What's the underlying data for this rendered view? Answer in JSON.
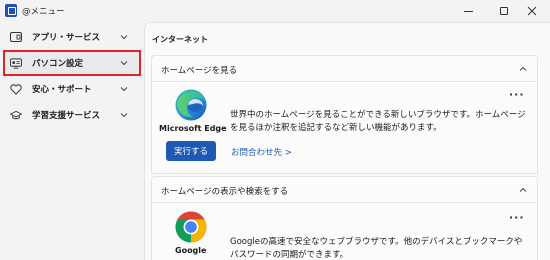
{
  "window": {
    "title": "@メニュー",
    "minimize_icon": "minimize-icon",
    "maximize_icon": "maximize-icon",
    "close_icon": "close-icon"
  },
  "sidebar": {
    "items": [
      {
        "label": "アプリ・サービス",
        "icon": "apps-icon",
        "selected": false
      },
      {
        "label": "パソコン設定",
        "icon": "pc-settings-icon",
        "selected": true
      },
      {
        "label": "安心・サポート",
        "icon": "heart-icon",
        "selected": false
      },
      {
        "label": "学習支援サービス",
        "icon": "graduation-cap-icon",
        "selected": false
      }
    ]
  },
  "main": {
    "section_title": "インターネット",
    "cards": [
      {
        "header": "ホームページを見る",
        "app_name": "Microsoft Edge",
        "description": "世界中のホームページを見ることができる新しいブラウザです。ホームページを見るほか注釈を追記するなど新しい機能があります。",
        "run_label": "実行する",
        "contact_label": "お問合わせ先 >",
        "more": "..."
      },
      {
        "header": "ホームページの表示や検索をする",
        "app_name": "Google",
        "description": "Googleの高速で安全なウェブブラウザです。他のデバイスとブックマークやパスワードの同期ができます。",
        "more": "..."
      }
    ]
  },
  "colors": {
    "accent": "#1f58b5",
    "highlight_border": "#d9262e"
  }
}
